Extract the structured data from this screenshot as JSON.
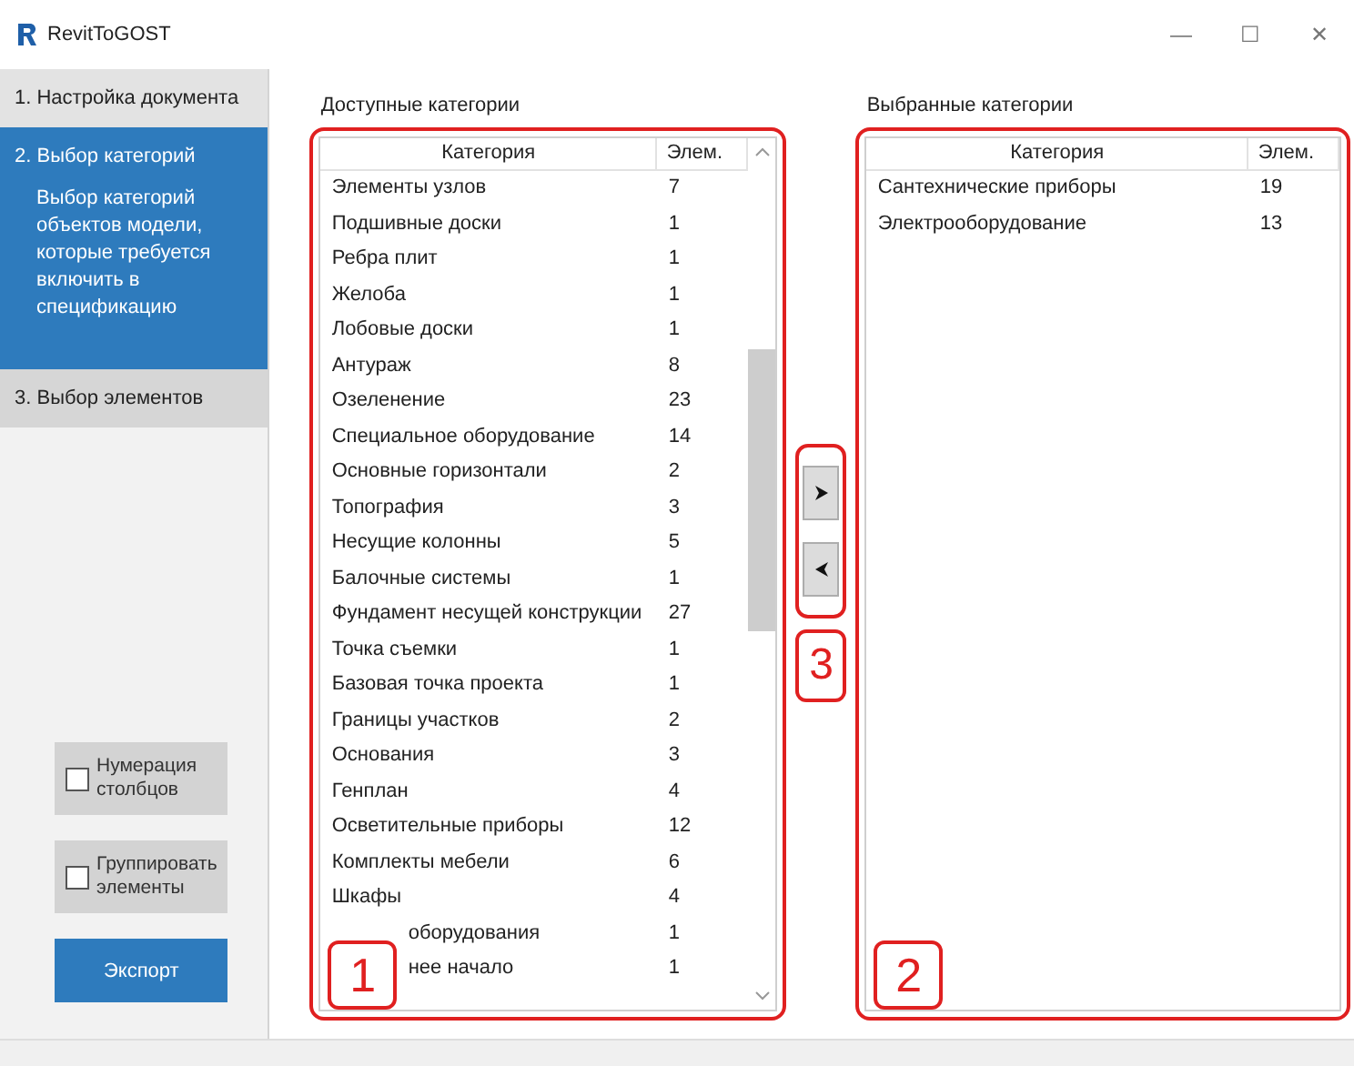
{
  "window": {
    "title": "RevitToGOST",
    "controls": [
      "—",
      "☐",
      "✕"
    ]
  },
  "steps": [
    {
      "label": "1. Настройка документа",
      "selected": false
    },
    {
      "label": "2. Выбор категорий",
      "selected": true,
      "description": "Выбор категорий объектов модели, которые требуется включить в спецификацию"
    },
    {
      "label": "3. Выбор элементов",
      "selected": false
    }
  ],
  "options": [
    {
      "label": "Нумерация столбцов",
      "checked": false
    },
    {
      "label": "Группировать элементы",
      "checked": false
    }
  ],
  "export_button": "Экспорт",
  "available": {
    "title": "Доступные категории",
    "columns": [
      "Категория",
      "Элем."
    ],
    "rows": [
      [
        "Элементы узлов",
        "7"
      ],
      [
        "Подшивные доски",
        "1"
      ],
      [
        "Ребра плит",
        "1"
      ],
      [
        "Желоба",
        "1"
      ],
      [
        "Лобовые доски",
        "1"
      ],
      [
        "Антураж",
        "8"
      ],
      [
        "Озеленение",
        "23"
      ],
      [
        "Специальное оборудование",
        "14"
      ],
      [
        "Основные горизонтали",
        "2"
      ],
      [
        "Топография",
        "3"
      ],
      [
        "Несущие колонны",
        "5"
      ],
      [
        "Балочные системы",
        "1"
      ],
      [
        "Фундамент несущей конструкции",
        "27"
      ],
      [
        "Точка съемки",
        "1"
      ],
      [
        "Базовая точка проекта",
        "1"
      ],
      [
        "Границы участков",
        "2"
      ],
      [
        "Основания",
        "3"
      ],
      [
        "Генплан",
        "4"
      ],
      [
        "Осветительные приборы",
        "12"
      ],
      [
        "Комплекты мебели",
        "6"
      ],
      [
        "Шкафы",
        "4"
      ],
      [
        "оборудования",
        "1"
      ],
      [
        "нее начало",
        "1"
      ]
    ]
  },
  "selected": {
    "title": "Выбранные категории",
    "columns": [
      "Категория",
      "Элем."
    ],
    "rows": [
      [
        "Сантехнические приборы",
        "19"
      ],
      [
        "Электрооборудование",
        "13"
      ]
    ]
  },
  "callouts": [
    "1",
    "2",
    "3"
  ]
}
